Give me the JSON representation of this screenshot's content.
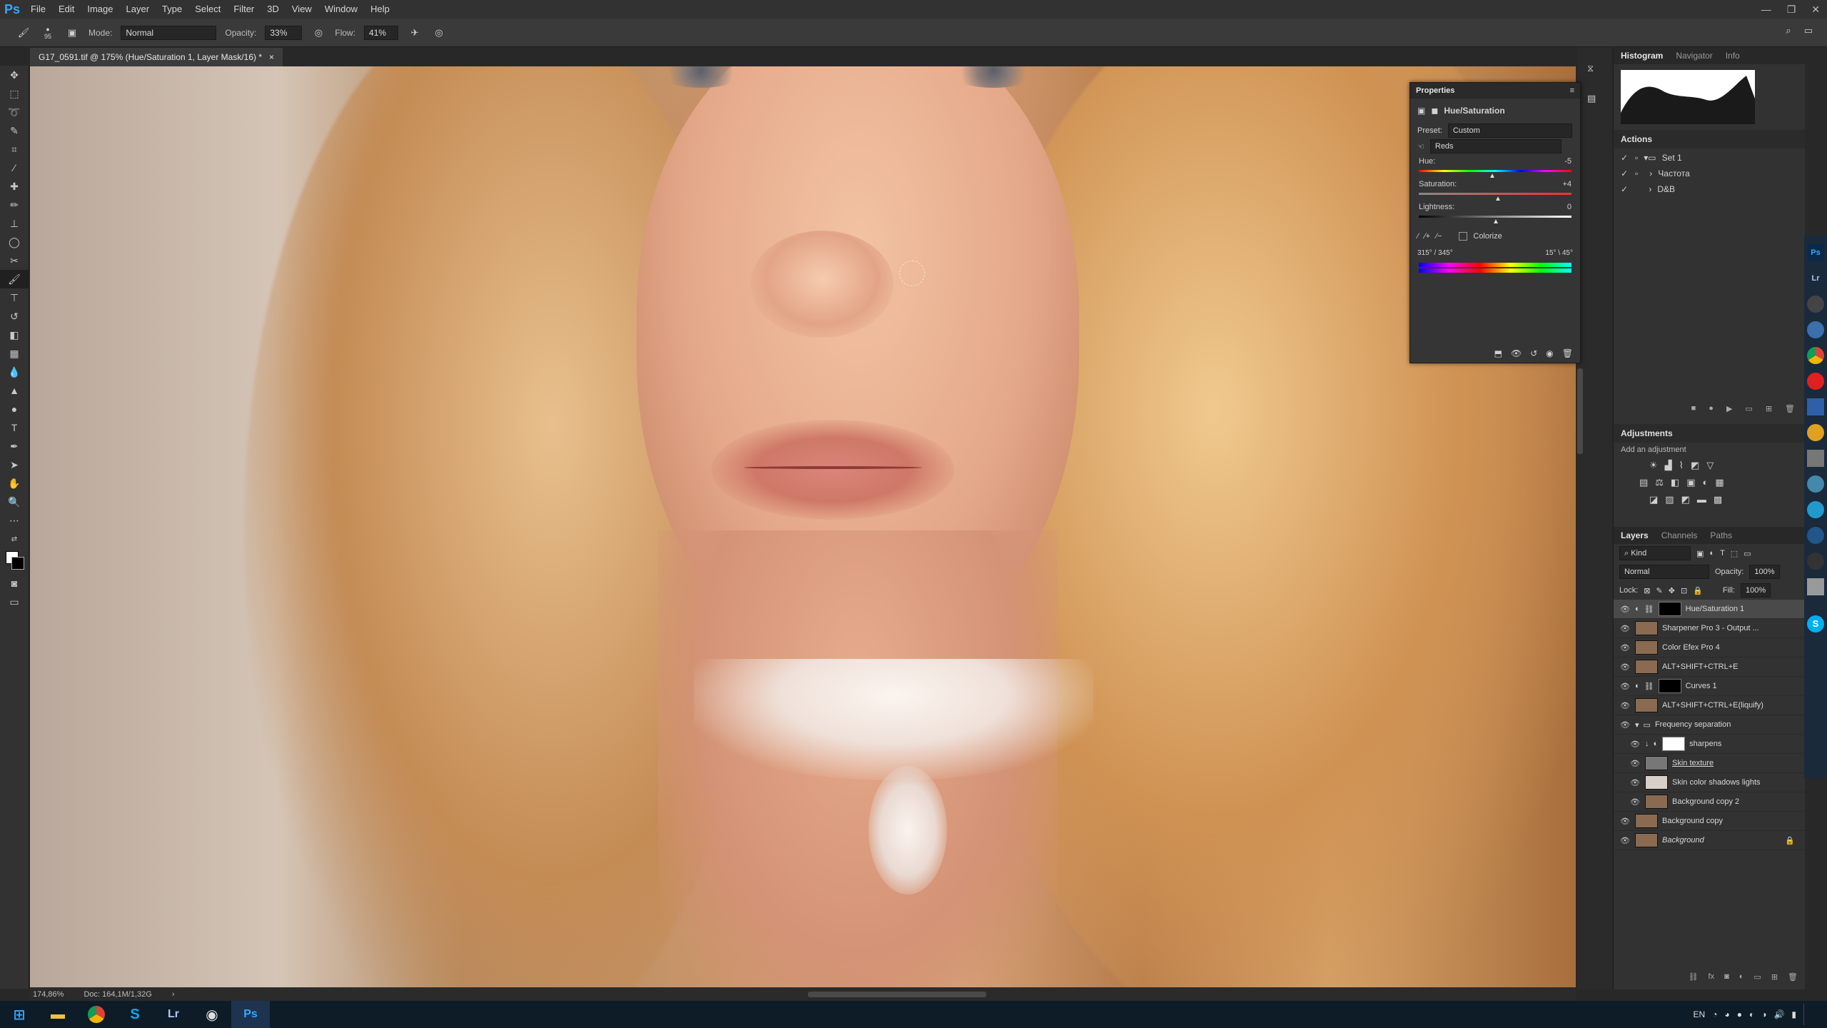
{
  "app": {
    "logo": "Ps",
    "menus": [
      "File",
      "Edit",
      "Image",
      "Layer",
      "Type",
      "Select",
      "Filter",
      "3D",
      "View",
      "Window",
      "Help"
    ]
  },
  "options_bar": {
    "brush_size": "95",
    "mode_label": "Mode:",
    "mode_value": "Normal",
    "opacity_label": "Opacity:",
    "opacity_value": "33%",
    "flow_label": "Flow:",
    "flow_value": "41%"
  },
  "document_tab": {
    "title": "G17_0591.tif @ 175% (Hue/Saturation 1, Layer Mask/16) *",
    "close": "×"
  },
  "toolbar": {
    "tools": [
      "move-icon",
      "marquee-icon",
      "lasso-icon",
      "quick-select-icon",
      "crop-icon",
      "eyedropper-icon",
      "healing-icon",
      "brush-icon",
      "stamp-icon",
      "history-brush-icon",
      "eraser-icon",
      "gradient-icon",
      "blur-icon",
      "dodge-icon",
      "pen-icon",
      "type-icon",
      "path-select-icon",
      "shape-icon",
      "hand-icon",
      "zoom-icon",
      "more-icon"
    ]
  },
  "properties_panel": {
    "title": "Properties",
    "adjustment_name": "Hue/Saturation",
    "preset_label": "Preset:",
    "preset_value": "Custom",
    "channel_value": "Reds",
    "hue_label": "Hue:",
    "hue_value": "-5",
    "saturation_label": "Saturation:",
    "saturation_value": "+4",
    "lightness_label": "Lightness:",
    "lightness_value": "0",
    "colorize_label": "Colorize",
    "range_left": "315° / 345°",
    "range_right": "15° \\ 45°"
  },
  "histogram_panel": {
    "tabs": [
      "Histogram",
      "Navigator",
      "Info"
    ]
  },
  "actions_panel": {
    "title": "Actions",
    "items": [
      {
        "label": "Set 1",
        "checked": true
      },
      {
        "label": "Частота",
        "checked": true
      },
      {
        "label": "D&B",
        "checked": true
      }
    ]
  },
  "adjustments_panel": {
    "title": "Adjustments",
    "subtitle": "Add an adjustment"
  },
  "layers_panel": {
    "tabs": [
      "Layers",
      "Channels",
      "Paths"
    ],
    "kind_label": "Kind",
    "blend_mode": "Normal",
    "opacity_label": "Opacity:",
    "opacity_value": "100%",
    "lock_label": "Lock:",
    "fill_label": "Fill:",
    "fill_value": "100%",
    "layers": [
      {
        "name": "Hue/Saturation 1",
        "selected": true
      },
      {
        "name": "Sharpener Pro 3 - Output ..."
      },
      {
        "name": "Color Efex Pro 4"
      },
      {
        "name": "ALT+SHIFT+CTRL+E"
      },
      {
        "name": "Curves 1"
      },
      {
        "name": "ALT+SHIFT+CTRL+E(liquify)"
      },
      {
        "name": "Frequency separation"
      },
      {
        "name": "sharpens"
      },
      {
        "name": "Skin texture"
      },
      {
        "name": "Skin color shadows lights"
      },
      {
        "name": "Background copy 2"
      },
      {
        "name": "Background copy"
      },
      {
        "name": "Background"
      }
    ]
  },
  "status_bar": {
    "zoom": "174,86%",
    "doc": "Doc: 164,1M/1,32G"
  },
  "taskbar": {
    "lang": "EN",
    "apps": [
      "Chrome",
      "Skype",
      "Lr",
      "Ps"
    ]
  }
}
